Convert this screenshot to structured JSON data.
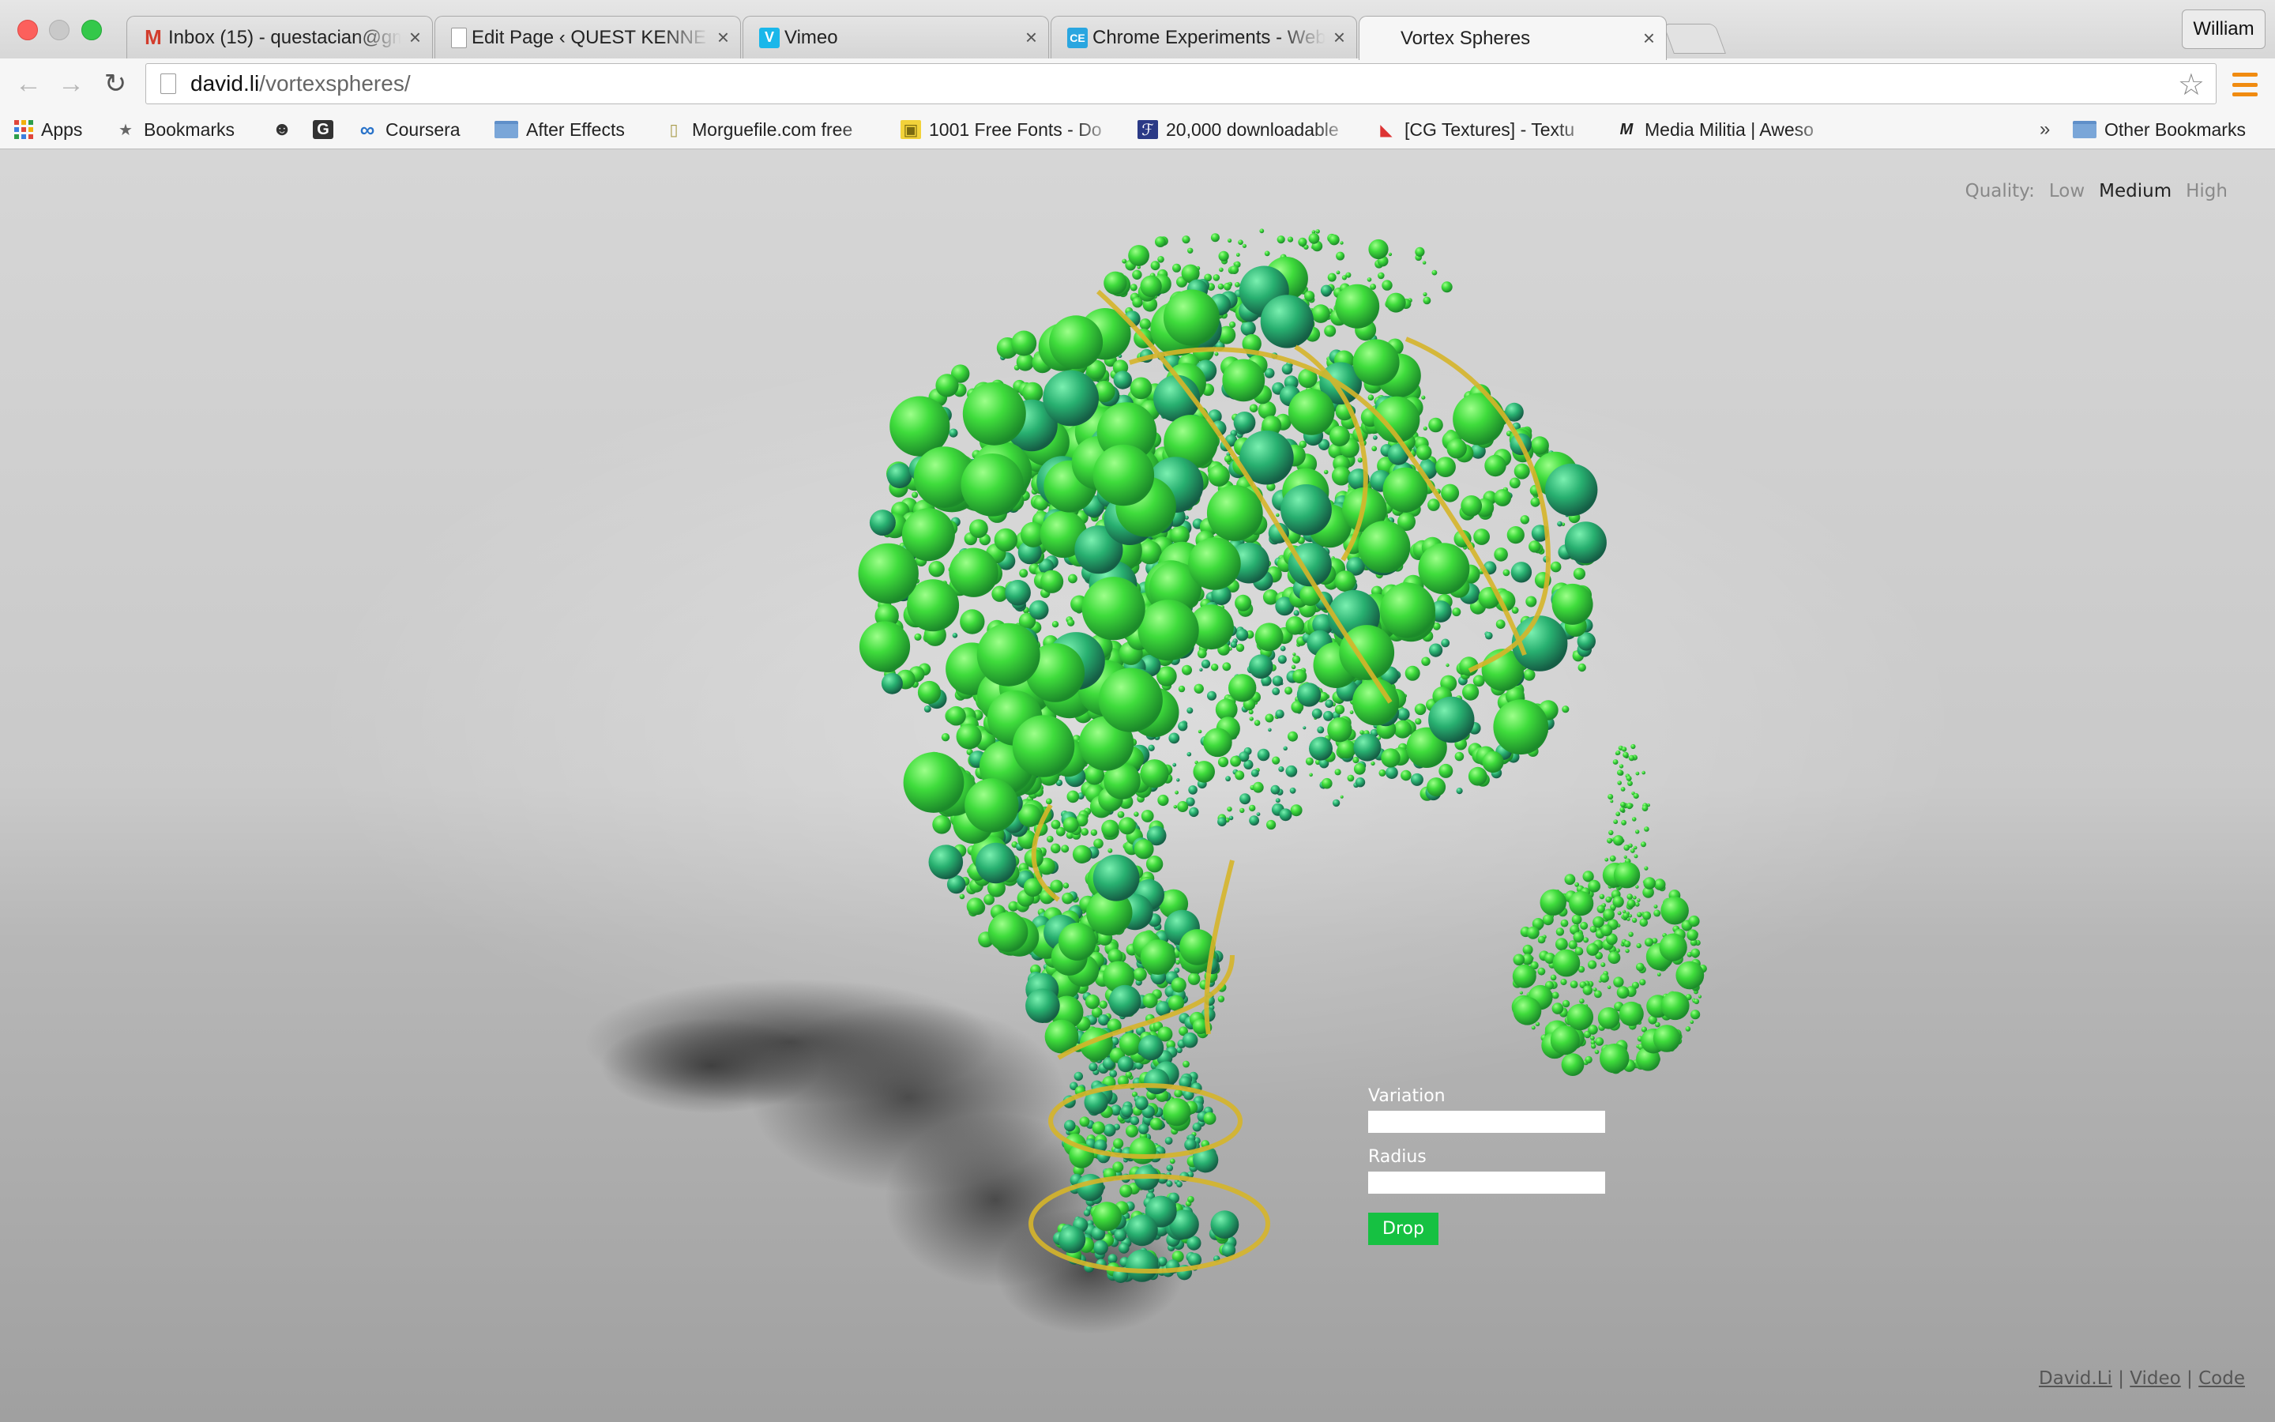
{
  "window": {
    "profile_name": "William"
  },
  "tabs": [
    {
      "title": "Inbox (15) - questacian@gm",
      "favicon": "gmail-icon",
      "close": "×"
    },
    {
      "title": "Edit Page ‹ QUEST KENNE",
      "favicon": "page-icon",
      "close": "×"
    },
    {
      "title": "Vimeo",
      "favicon": "vimeo-icon",
      "fav_text": "V",
      "close": "×"
    },
    {
      "title": "Chrome Experiments - Web",
      "favicon": "chrome-experiments-icon",
      "fav_text": "CE",
      "close": "×"
    },
    {
      "title": "Vortex Spheres",
      "favicon": "none",
      "close": "×",
      "active": true
    }
  ],
  "toolbar": {
    "back_icon": "←",
    "forward_icon": "→",
    "reload_icon": "↻",
    "url_host": "david.li",
    "url_path": "/vortexspheres/",
    "star_icon": "☆"
  },
  "bookmarks": {
    "items": [
      {
        "label": "Apps",
        "icon": "apps-grid-icon"
      },
      {
        "label": "Bookmarks",
        "icon": "star-icon",
        "glyph": "★"
      },
      {
        "label": "",
        "icon": "reddit-icon",
        "glyph": "☻"
      },
      {
        "label": "",
        "icon": "g-icon",
        "glyph": "G"
      },
      {
        "label": "Coursera",
        "icon": "coursera-icon",
        "glyph": "∞"
      },
      {
        "label": "After Effects",
        "icon": "folder-icon"
      },
      {
        "label": "Morguefile.com free",
        "icon": "morguefile-icon",
        "glyph": "▯"
      },
      {
        "label": "1001 Free Fonts - Do",
        "icon": "fonts-icon",
        "glyph": "▣"
      },
      {
        "label": "20,000 downloadable",
        "icon": "font-icon",
        "glyph": "ℱ"
      },
      {
        "label": "[CG Textures] - Textu",
        "icon": "cgtextures-icon",
        "glyph": "◣"
      },
      {
        "label": "Media Militia | Aweso",
        "icon": "mediamilitia-icon",
        "glyph": "M"
      }
    ],
    "overflow": "»",
    "other": "Other Bookmarks"
  },
  "page": {
    "quality_label": "Quality:",
    "quality_options": [
      "Low",
      "Medium",
      "High"
    ],
    "quality_selected": "Medium",
    "variation_label": "Variation",
    "radius_label": "Radius",
    "drop_label": "Drop",
    "footer": {
      "link1": "David.Li",
      "sep1": " | ",
      "link2": "Video",
      "sep2": " | ",
      "link3": "Code"
    }
  },
  "colors": {
    "accent_green": "#16c142",
    "sphere_light": "#3fdc3c",
    "sphere_dark": "#1e7a52",
    "ribbon": "#d6b52a"
  }
}
